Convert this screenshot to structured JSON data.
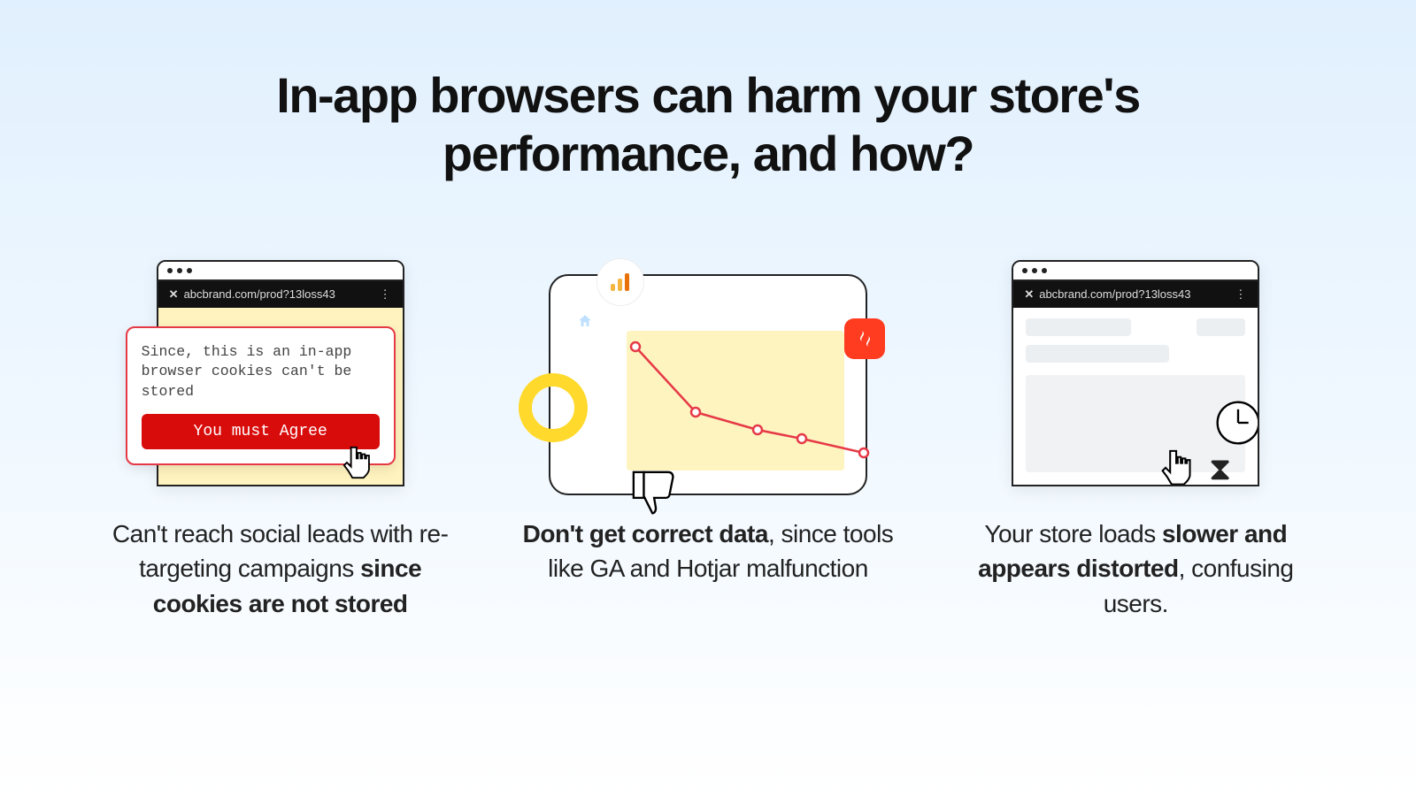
{
  "title": "In-app browsers can harm your store's performance, and how?",
  "address_bar_url": "abcbrand.com/prod?13loss43",
  "col1": {
    "popup_message": "Since, this is an in-app browser cookies can't be stored",
    "popup_button": "You must Agree",
    "caption_pre": "Can't reach social leads with re-targeting campaigns ",
    "caption_bold": "since cookies are not stored"
  },
  "col2": {
    "caption_bold": "Don't get correct data",
    "caption_post": ", since tools like GA and Hotjar malfunction"
  },
  "col3": {
    "caption_pre": "Your store loads ",
    "caption_bold": "slower and appears distorted",
    "caption_post": ", confusing users."
  },
  "chart_data": {
    "type": "line",
    "x": [
      0,
      1,
      2,
      3,
      4
    ],
    "values": [
      92,
      55,
      45,
      40,
      32
    ],
    "ylim": [
      0,
      100
    ],
    "title": "",
    "xlabel": "",
    "ylabel": ""
  }
}
